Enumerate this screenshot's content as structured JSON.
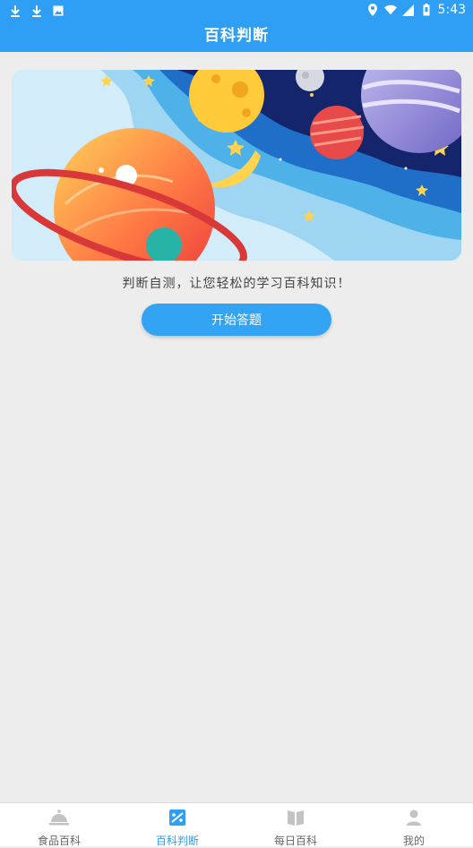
{
  "status_bar": {
    "time": "5:43",
    "left_icons": [
      "download-icon",
      "download-icon",
      "image-icon"
    ],
    "right_icons": [
      "location-icon",
      "wifi-icon",
      "signal-icon",
      "battery-icon"
    ]
  },
  "app_bar": {
    "title": "百科判断"
  },
  "main": {
    "subtitle": "判断自测，让您轻松的学习百科知识！",
    "start_button": "开始答题"
  },
  "bottom_nav": {
    "active_index": 1,
    "active_color": "#2e9ff5",
    "items": [
      {
        "label": "食品百科",
        "icon": "cloche-icon"
      },
      {
        "label": "百科判断",
        "icon": "quiz-icon"
      },
      {
        "label": "每日百科",
        "icon": "book-icon"
      },
      {
        "label": "我的",
        "icon": "person-icon"
      }
    ]
  },
  "colors": {
    "primary": "#2e9ff5",
    "background": "#ededed"
  }
}
